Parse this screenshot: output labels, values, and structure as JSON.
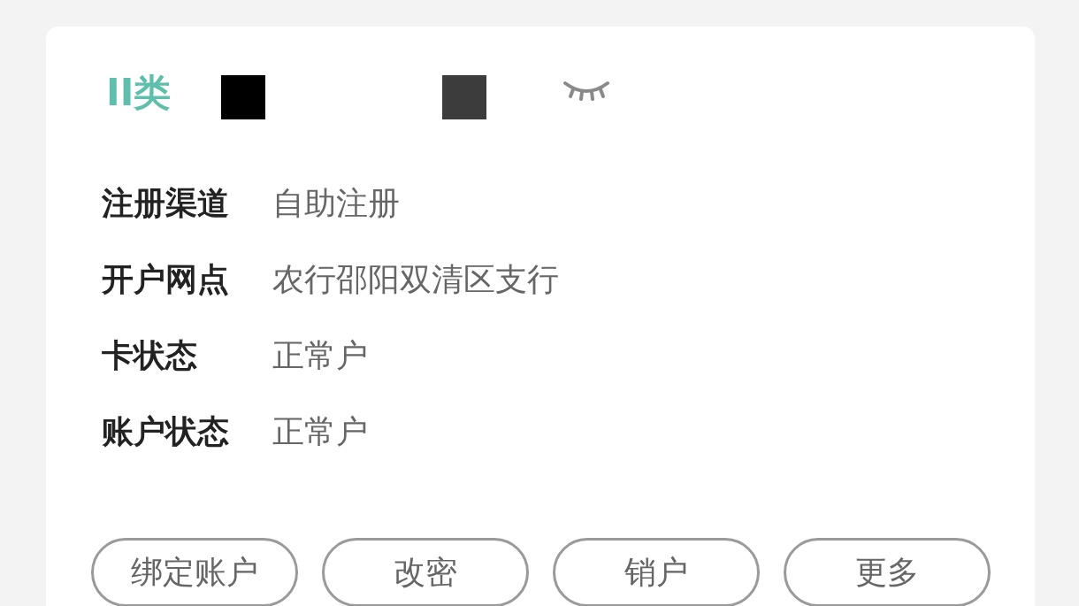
{
  "card": {
    "badge": "II类",
    "masked": true,
    "fields": [
      {
        "label": "注册渠道",
        "value": "自助注册"
      },
      {
        "label": "开户网点",
        "value": "农行邵阳双清区支行"
      },
      {
        "label": "卡状态",
        "value": "正常户"
      },
      {
        "label": "账户状态",
        "value": "正常户"
      }
    ],
    "buttons": [
      "绑定账户",
      "改密",
      "销户",
      "更多"
    ]
  }
}
